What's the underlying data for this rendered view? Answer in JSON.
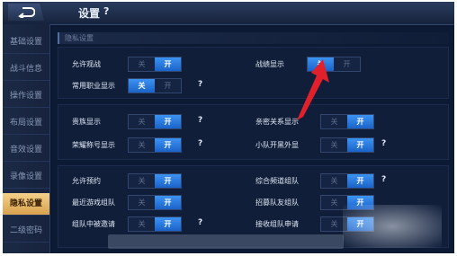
{
  "header": {
    "title": "设置",
    "help": "?"
  },
  "sidebar": {
    "items": [
      {
        "label": "基础设置"
      },
      {
        "label": "战斗信息"
      },
      {
        "label": "操作设置"
      },
      {
        "label": "布局设置"
      },
      {
        "label": "音效设置"
      },
      {
        "label": "录像设置"
      },
      {
        "label": "隐私设置",
        "active": true
      },
      {
        "label": "二级密码"
      }
    ]
  },
  "section": {
    "title": "隐私设置"
  },
  "toggle": {
    "off": "关",
    "on": "开"
  },
  "settings": {
    "allow_spectate": {
      "label": "允许观战",
      "value": "开"
    },
    "show_stats": {
      "label": "战绩显示",
      "value": "关"
    },
    "common_role": {
      "label": "常用职业显示",
      "value": "关",
      "help": "?"
    },
    "noble": {
      "label": "贵族显示",
      "value": "开",
      "help": "?"
    },
    "intimate": {
      "label": "亲密关系显示",
      "value": "开"
    },
    "honor": {
      "label": "荣耀称号显示",
      "value": "开",
      "help": "?"
    },
    "team_outside": {
      "label": "小队开黑外显",
      "value": "开",
      "help": "?"
    },
    "allow_booking": {
      "label": "允许预约",
      "value": "开"
    },
    "channel_team": {
      "label": "综合频道组队",
      "value": "开",
      "help": "?"
    },
    "recent_team": {
      "label": "最近游戏组队",
      "value": "开"
    },
    "recruit_team": {
      "label": "招募队友组队",
      "value": "开"
    },
    "team_invited": {
      "label": "组队中被邀请",
      "value": "开",
      "help": "?"
    },
    "accept_request": {
      "label": "接收组队申请",
      "value": "开"
    }
  },
  "colors": {
    "background": "#0b1730",
    "toggle_on": "#2b7be0",
    "active_tab": "#e8b86a",
    "arrow": "#e0202a"
  },
  "icons": {
    "back": "back-arrow-icon",
    "pointer": "red-arrow-icon"
  }
}
